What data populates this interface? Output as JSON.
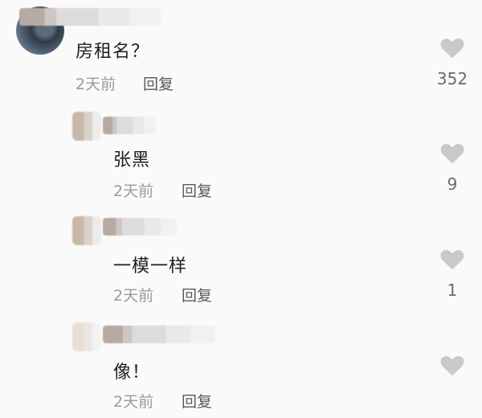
{
  "comments": [
    {
      "text": "房租名？",
      "time": "2天前",
      "reply_label": "回复",
      "likes": "352",
      "heart_icon": "heart-icon"
    },
    {
      "text": "张黑",
      "time": "2天前",
      "reply_label": "回复",
      "likes": "9",
      "heart_icon": "heart-icon"
    },
    {
      "text": "一模一样",
      "time": "2天前",
      "reply_label": "回复",
      "likes": "1",
      "heart_icon": "heart-icon"
    },
    {
      "text": "像！",
      "time": "2天前",
      "reply_label": "回复",
      "likes": "",
      "heart_icon": "heart-icon"
    }
  ],
  "colors": {
    "heart": "#c9c9c9",
    "background": "#fafafa"
  }
}
